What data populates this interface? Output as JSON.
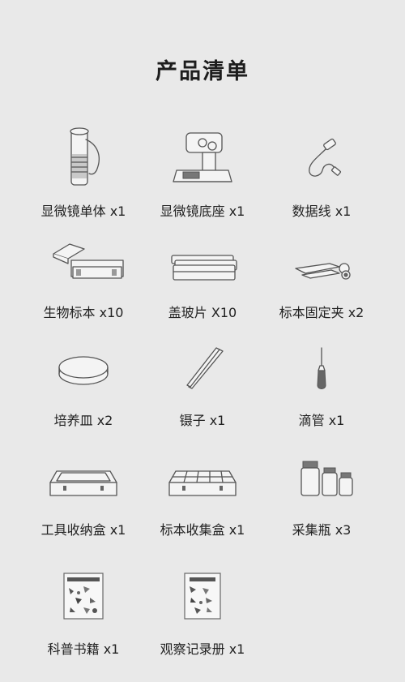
{
  "title": "产品清单",
  "items": [
    {
      "label": "显微镜单体 x1",
      "icon": "microscope-body-icon"
    },
    {
      "label": "显微镜底座 x1",
      "icon": "microscope-base-icon"
    },
    {
      "label": "数据线 x1",
      "icon": "usb-cable-icon"
    },
    {
      "label": "生物标本 x10",
      "icon": "specimen-slides-icon"
    },
    {
      "label": "盖玻片 X10",
      "icon": "cover-glass-icon"
    },
    {
      "label": "标本固定夹 x2",
      "icon": "specimen-clip-icon"
    },
    {
      "label": "培养皿 x2",
      "icon": "petri-dish-icon"
    },
    {
      "label": "镊子 x1",
      "icon": "tweezers-icon"
    },
    {
      "label": "滴管 x1",
      "icon": "dropper-icon"
    },
    {
      "label": "工具收纳盒 x1",
      "icon": "tool-box-icon"
    },
    {
      "label": "标本收集盒 x1",
      "icon": "specimen-box-icon"
    },
    {
      "label": "采集瓶 x3",
      "icon": "collection-bottles-icon"
    },
    {
      "label": "科普书籍 x1",
      "icon": "science-book-icon"
    },
    {
      "label": "观察记录册 x1",
      "icon": "record-book-icon"
    }
  ]
}
